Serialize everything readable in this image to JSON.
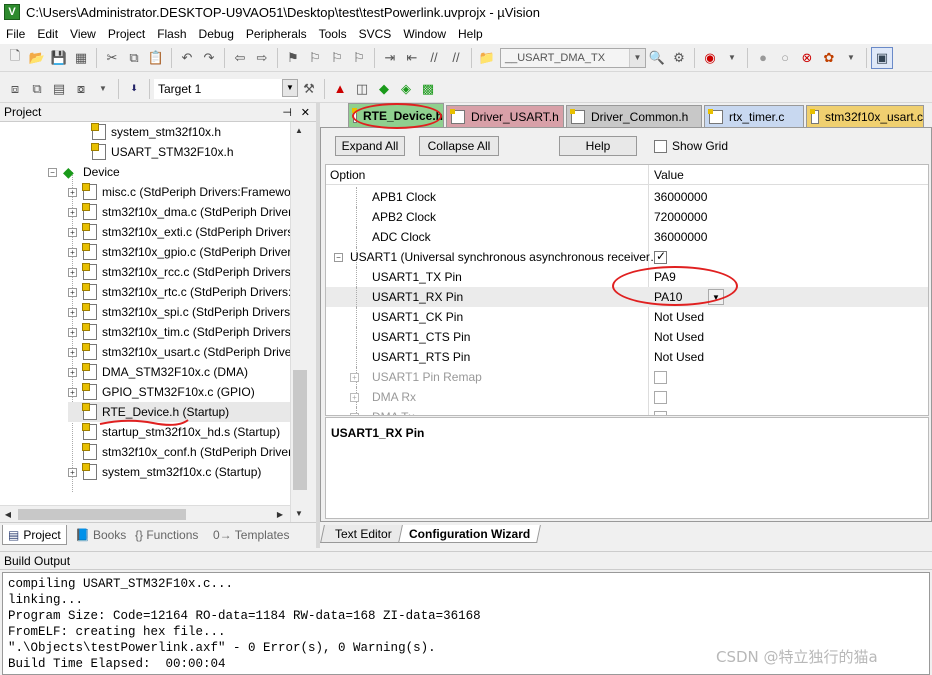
{
  "window": {
    "title": "C:\\Users\\Administrator.DESKTOP-U9VAO51\\Desktop\\test\\testPowerlink.uvprojx - µVision",
    "app_icon": "V"
  },
  "menu": [
    "File",
    "Edit",
    "View",
    "Project",
    "Flash",
    "Debug",
    "Peripherals",
    "Tools",
    "SVCS",
    "Window",
    "Help"
  ],
  "toolbar": {
    "find_combo": "__USART_DMA_TX",
    "target_combo": "Target 1"
  },
  "project_panel": {
    "title": "Project",
    "pin_icon": "⊣",
    "close_icon": "✕",
    "items": [
      {
        "label": "system_stm32f10x.h",
        "expandable": false
      },
      {
        "label": "USART_STM32F10x.h",
        "expandable": false
      },
      {
        "label": "Device",
        "expandable": true,
        "expanded": true
      },
      {
        "label": "misc.c (StdPeriph Drivers:Framewo",
        "expandable": true
      },
      {
        "label": "stm32f10x_dma.c (StdPeriph Driver",
        "expandable": true
      },
      {
        "label": "stm32f10x_exti.c (StdPeriph Drivers:",
        "expandable": true
      },
      {
        "label": "stm32f10x_gpio.c (StdPeriph Driver",
        "expandable": true
      },
      {
        "label": "stm32f10x_rcc.c (StdPeriph Drivers:",
        "expandable": true
      },
      {
        "label": "stm32f10x_rtc.c (StdPeriph Drivers:F",
        "expandable": true
      },
      {
        "label": "stm32f10x_spi.c (StdPeriph Drivers:S",
        "expandable": true
      },
      {
        "label": "stm32f10x_tim.c (StdPeriph Drivers:",
        "expandable": true
      },
      {
        "label": "stm32f10x_usart.c (StdPeriph Driver",
        "expandable": true
      },
      {
        "label": "DMA_STM32F10x.c (DMA)",
        "expandable": true
      },
      {
        "label": "GPIO_STM32F10x.c (GPIO)",
        "expandable": true
      },
      {
        "label": "RTE_Device.h (Startup)",
        "expandable": false
      },
      {
        "label": "startup_stm32f10x_hd.s (Startup)",
        "expandable": false
      },
      {
        "label": "stm32f10x_conf.h (StdPeriph Driver",
        "expandable": false
      },
      {
        "label": "system_stm32f10x.c (Startup)",
        "expandable": true
      }
    ],
    "bottom_tabs": [
      "Project",
      "Books",
      "{} Functions",
      "0→ Templates"
    ]
  },
  "doc_tabs": [
    {
      "label": "RTE_Device.h",
      "color": "#8fd08f"
    },
    {
      "label": "Driver_USART.h",
      "color": "#d8a0a8"
    },
    {
      "label": "Driver_Common.h",
      "color": "#c8c8c8"
    },
    {
      "label": "rtx_timer.c",
      "color": "#c8d8f0"
    },
    {
      "label": "stm32f10x_usart.c",
      "color": "#f0d070"
    }
  ],
  "config": {
    "expand_all": "Expand All",
    "collapse_all": "Collapse All",
    "help": "Help",
    "show_grid": "Show Grid",
    "col_option": "Option",
    "col_value": "Value",
    "rows": [
      {
        "option": "APB1 Clock",
        "value": "36000000",
        "indent": 2,
        "kind": "text"
      },
      {
        "option": "APB2 Clock",
        "value": "72000000",
        "indent": 2,
        "kind": "text"
      },
      {
        "option": "ADC Clock",
        "value": "36000000",
        "indent": 2,
        "kind": "text"
      },
      {
        "option": "USART1 (Universal synchronous asynchronous receiver…",
        "value": "",
        "indent": 1,
        "kind": "check-on",
        "expander": "−"
      },
      {
        "option": "USART1_TX Pin",
        "value": "PA9",
        "indent": 2,
        "kind": "text"
      },
      {
        "option": "USART1_RX Pin",
        "value": "PA10",
        "indent": 2,
        "kind": "select"
      },
      {
        "option": "USART1_CK Pin",
        "value": "Not Used",
        "indent": 2,
        "kind": "text"
      },
      {
        "option": "USART1_CTS Pin",
        "value": "Not Used",
        "indent": 2,
        "kind": "text"
      },
      {
        "option": "USART1_RTS Pin",
        "value": "Not Used",
        "indent": 2,
        "kind": "text"
      },
      {
        "option": "USART1 Pin Remap",
        "value": "",
        "indent": 2,
        "kind": "check-dim",
        "expander": "+"
      },
      {
        "option": "DMA Rx",
        "value": "",
        "indent": 2,
        "kind": "check-dim",
        "expander": "+"
      },
      {
        "option": "DMA Tx",
        "value": "",
        "indent": 2,
        "kind": "check-dim",
        "expander": "+"
      }
    ],
    "description": "USART1_RX Pin",
    "bottom_tabs": [
      "Text Editor",
      "Configuration Wizard"
    ]
  },
  "build_output": {
    "title": "Build Output",
    "lines": [
      "compiling USART_STM32F10x.c...",
      "linking...",
      "Program Size: Code=12164 RO-data=1184 RW-data=168 ZI-data=36168",
      "FromELF: creating hex file...",
      "\".\\Objects\\testPowerlink.axf\" - 0 Error(s), 0 Warning(s).",
      "Build Time Elapsed:  00:00:04"
    ],
    "watermark": "CSDN @特立独行的猫a"
  }
}
